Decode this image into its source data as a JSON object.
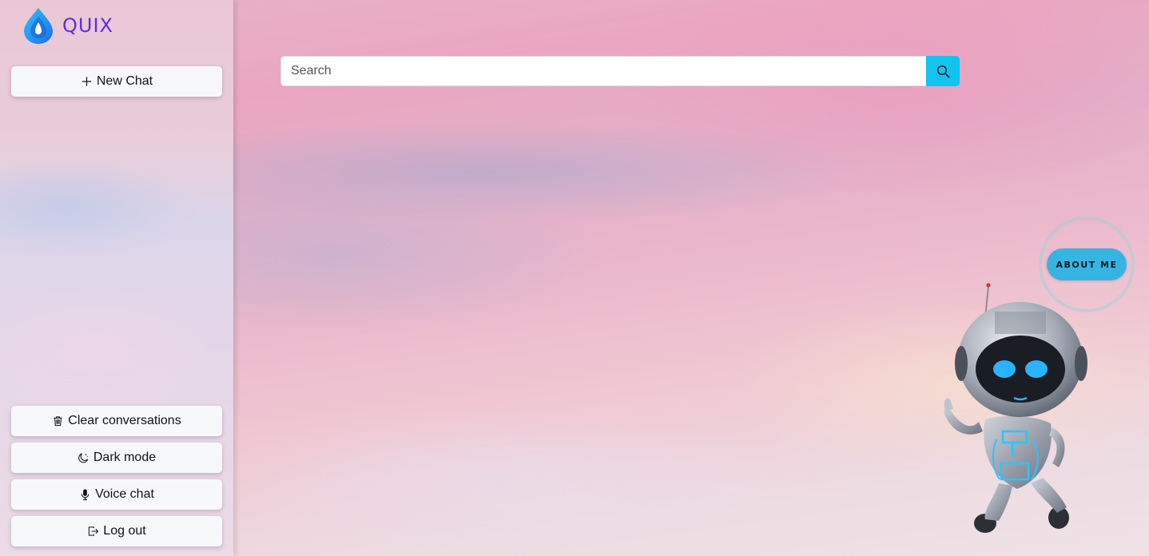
{
  "app": {
    "name": "QUIX",
    "brand_color": "#5b2ee6",
    "accent": "#10c4ef"
  },
  "sidebar": {
    "new_chat": {
      "label": "New Chat",
      "icon": "plus-icon"
    },
    "bottom_items": [
      {
        "label": "Clear conversations",
        "icon": "trash-icon"
      },
      {
        "label": "Dark mode",
        "icon": "moon-stars-icon"
      },
      {
        "label": "Voice chat",
        "icon": "microphone-icon"
      },
      {
        "label": "Log out",
        "icon": "logout-icon"
      }
    ]
  },
  "search": {
    "placeholder": "Search",
    "value": "",
    "icon": "search-icon"
  },
  "about": {
    "label": "ABOUT ME",
    "color": "#36b5e2"
  },
  "mascot": {
    "icon": "robot-mascot"
  }
}
